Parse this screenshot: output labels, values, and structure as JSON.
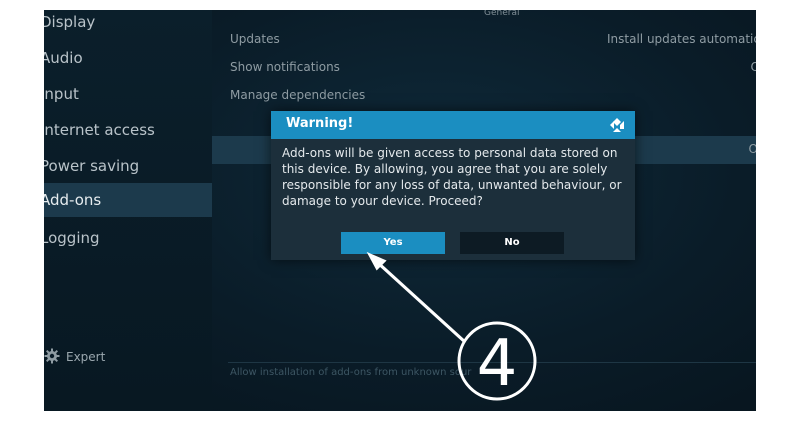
{
  "sidebar": {
    "items": [
      {
        "label": "Display"
      },
      {
        "label": "Audio"
      },
      {
        "label": "Input"
      },
      {
        "label": "Internet access"
      },
      {
        "label": "Power saving"
      },
      {
        "label": "Add-ons",
        "active": true
      },
      {
        "label": "Logging"
      }
    ],
    "expert_label": "Expert"
  },
  "main": {
    "section_header": "General",
    "rows": [
      {
        "label": "Updates",
        "value": "Install updates automatic"
      },
      {
        "label": "Show notifications",
        "value": "O"
      },
      {
        "label": "Manage dependencies",
        "value": ""
      }
    ],
    "highlight_value": "O",
    "bottom_hint": "Allow installation of add-ons from unknown sour"
  },
  "dialog": {
    "title": "Warning!",
    "message": "Add-ons will be given access to personal data stored on this device. By allowing, you agree that you are solely responsible for any loss of data, unwanted behaviour, or damage to your device. Proceed?",
    "yes_label": "Yes",
    "no_label": "No",
    "accent_color": "#1b8ec1"
  },
  "annotation": {
    "step_number": "4"
  }
}
